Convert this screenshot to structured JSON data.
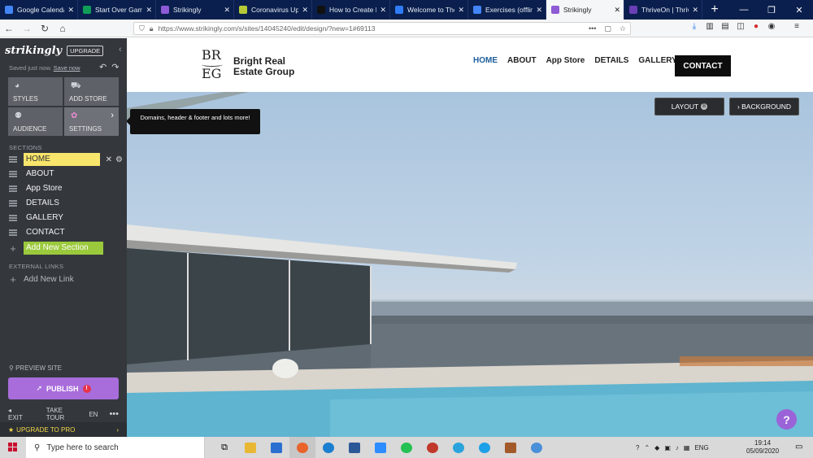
{
  "browser": {
    "tabs": [
      {
        "label": "Google Calendar",
        "favicon_color": "#4285f4",
        "icon": "calendar-icon"
      },
      {
        "label": "Start Over Game",
        "favicon_color": "#0f9d58",
        "icon": "sheet-icon"
      },
      {
        "label": "Strikingly",
        "favicon_color": "#8e5ad6",
        "icon": "strikingly-icon"
      },
      {
        "label": "Coronavirus Upd",
        "favicon_color": "#b5c938",
        "icon": "doc-icon"
      },
      {
        "label": "How to Create M",
        "favicon_color": "#111111",
        "icon": "medium-icon"
      },
      {
        "label": "Welcome to The",
        "favicon_color": "#2f7cf6",
        "icon": "page-icon"
      },
      {
        "label": "Exercises (offline",
        "favicon_color": "#4285f4",
        "icon": "docs-icon"
      },
      {
        "label": "Strikingly",
        "favicon_color": "#8e5ad6",
        "icon": "strikingly-icon"
      },
      {
        "label": "ThriveOn | Thriv",
        "favicon_color": "#6a3fb5",
        "icon": "thriveon-icon"
      }
    ],
    "active_tab_index": 7,
    "url": "https://www.strikingly.com/s/sites/14045240/edit/design/?new=1#69113"
  },
  "sidebar": {
    "brand": "strikingly",
    "upgrade_label": "UPGRADE",
    "saved_status": "Saved just now.",
    "save_now_link": "Save now",
    "tools": [
      {
        "label": "STYLES",
        "icon": "palette-icon"
      },
      {
        "label": "ADD STORE",
        "icon": "store-icon"
      },
      {
        "label": "AUDIENCE",
        "icon": "audience-icon"
      },
      {
        "label": "SETTINGS",
        "icon": "settings-flower-icon"
      }
    ],
    "sections_heading": "SECTIONS",
    "sections": [
      "HOME",
      "ABOUT",
      "App Store",
      "DETAILS",
      "GALLERY",
      "CONTACT"
    ],
    "active_section_index": 0,
    "add_section_label": "Add New Section",
    "external_links_heading": "EXTERNAL LINKS",
    "add_link_label": "Add New Link",
    "preview_label": "PREVIEW SITE",
    "publish_label": "PUBLISH",
    "publish_badge": "!",
    "footer": {
      "exit": "EXIT",
      "tour": "TAKE TOUR",
      "lang": "EN"
    },
    "upgrade_pro_label": "UPGRADE TO PRO",
    "accent_publish": "#a86ddb",
    "accent_add": "#9bc93c",
    "accent_active": "#f8e56b"
  },
  "site": {
    "logo_line1": "BR",
    "logo_line2": "EG",
    "company_line1": "Bright Real",
    "company_line2": "Estate Group",
    "nav": [
      "HOME",
      "ABOUT",
      "App Store",
      "DETAILS",
      "GALLERY"
    ],
    "contact_label": "CONTACT",
    "tooltip": "Domains, header & footer and lots more!",
    "layout_label": "LAYOUT",
    "layout_badge": "B",
    "background_label": "› BACKGROUND",
    "help_label": "?"
  },
  "taskbar": {
    "search_placeholder": "Type here to search",
    "lang": "ENG",
    "time": "19:14",
    "date": "05/09/2020"
  }
}
